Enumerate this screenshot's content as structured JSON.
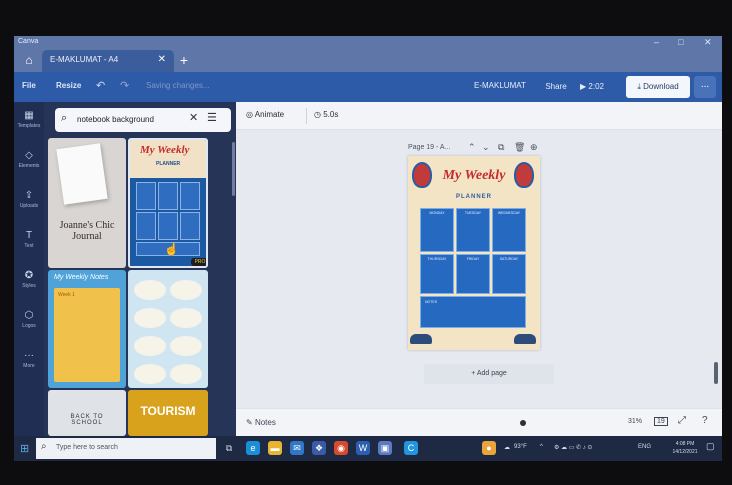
{
  "window": {
    "app_caption": "Canva",
    "tab_title": "E-MAKLUMAT - A4",
    "tab_close": "✕",
    "new_tab": "+",
    "controls": [
      "–",
      "□",
      "✕"
    ]
  },
  "menubar": {
    "file": "File",
    "resize": "Resize",
    "saving": "Saving changes...",
    "doc_name": "E-MAKLUMAT",
    "share": "Share",
    "duration": "2:02",
    "download": "Download",
    "more": "..."
  },
  "rail": {
    "items": [
      {
        "icon": "templates-icon",
        "label": "Templates"
      },
      {
        "icon": "elements-icon",
        "label": "Elements"
      },
      {
        "icon": "uploads-icon",
        "label": "Uploads"
      },
      {
        "icon": "text-icon",
        "label": "Text"
      },
      {
        "icon": "styles-icon",
        "label": "Styles"
      },
      {
        "icon": "logos-icon",
        "label": "Logos"
      },
      {
        "icon": "more-icon",
        "label": "More"
      }
    ]
  },
  "search": {
    "query": "notebook background"
  },
  "thumbnails": {
    "t1_title": "Joanne's Chic Journal",
    "t2_title": "My Weekly",
    "t2_sub": "PLANNER",
    "t2_badge": "PRO",
    "t3_title": "My Weekly Notes",
    "t3_tag": "Week 1",
    "t5_title": "BACK TO SCHOOL",
    "t6_title": "TOURISM"
  },
  "toolbar": {
    "animate": "Animate",
    "duration": "5.0s"
  },
  "canvas": {
    "page_label": "Page 19 - A...",
    "planner_title": "My Weekly",
    "planner_sub": "PLANNER",
    "days": [
      "MONDAY",
      "TUESDAY",
      "WEDNESDAY",
      "THURSDAY",
      "FRIDAY",
      "SATURDAY"
    ],
    "notes_label": "NOTES",
    "add_page": "+ Add page"
  },
  "footer": {
    "notes": "Notes",
    "zoom": "31%",
    "page_count": "19"
  },
  "taskbar": {
    "search_placeholder": "Type here to search",
    "weather": "93°F",
    "lang": "ENG",
    "time": "4:08 PM",
    "date": "14/12/2021"
  }
}
